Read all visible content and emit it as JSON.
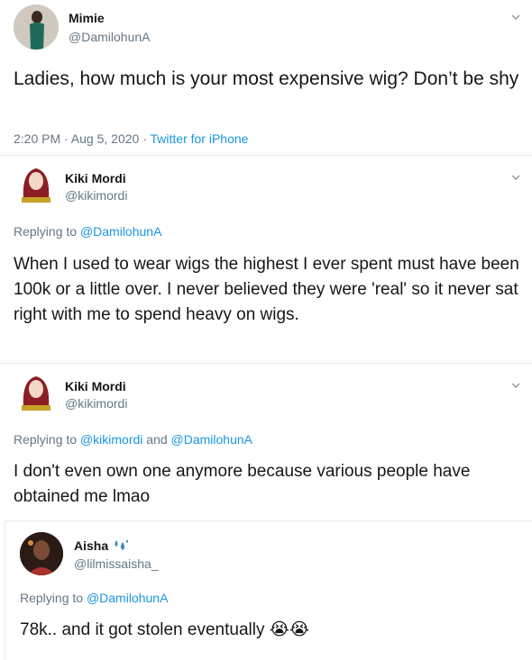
{
  "tweet1": {
    "name": "Mimie",
    "handle": "@DamilohunA",
    "text": "Ladies, how much is your most expensive wig? Don’t be shy",
    "time": "2:20 PM · Aug 5, 2020 · ",
    "source": "Twitter for iPhone"
  },
  "tweet2": {
    "name": "Kiki Mordi",
    "handle": "@kikimordi",
    "reply_prefix": "Replying to ",
    "reply_to": "@DamilohunA",
    "text": "When I used to wear wigs the highest I ever spent must have been 100k or a little over. I never believed they were 'real' so it never sat right with me to spend heavy on wigs."
  },
  "tweet3": {
    "name": "Kiki Mordi",
    "handle": "@kikimordi",
    "reply_prefix": "Replying to ",
    "reply_to_1": "@kikimordi",
    "reply_and": " and ",
    "reply_to_2": "@DamilohunA",
    "text": "I don't even own one anymore because various people have obtained me lmao"
  },
  "tweet4": {
    "name": "Aisha",
    "handle": "@lilmissaisha_",
    "reply_prefix": "Replying to ",
    "reply_to": "@DamilohunA",
    "text": "78k.. and it got stolen eventually ",
    "emoji": "😭😭"
  },
  "icons": {
    "chevron": "chevron-down-icon",
    "name_emoji": "sweat-droplets-icon"
  },
  "colors": {
    "link": "#1b95e0",
    "muted": "#657786",
    "text": "#14171a"
  }
}
